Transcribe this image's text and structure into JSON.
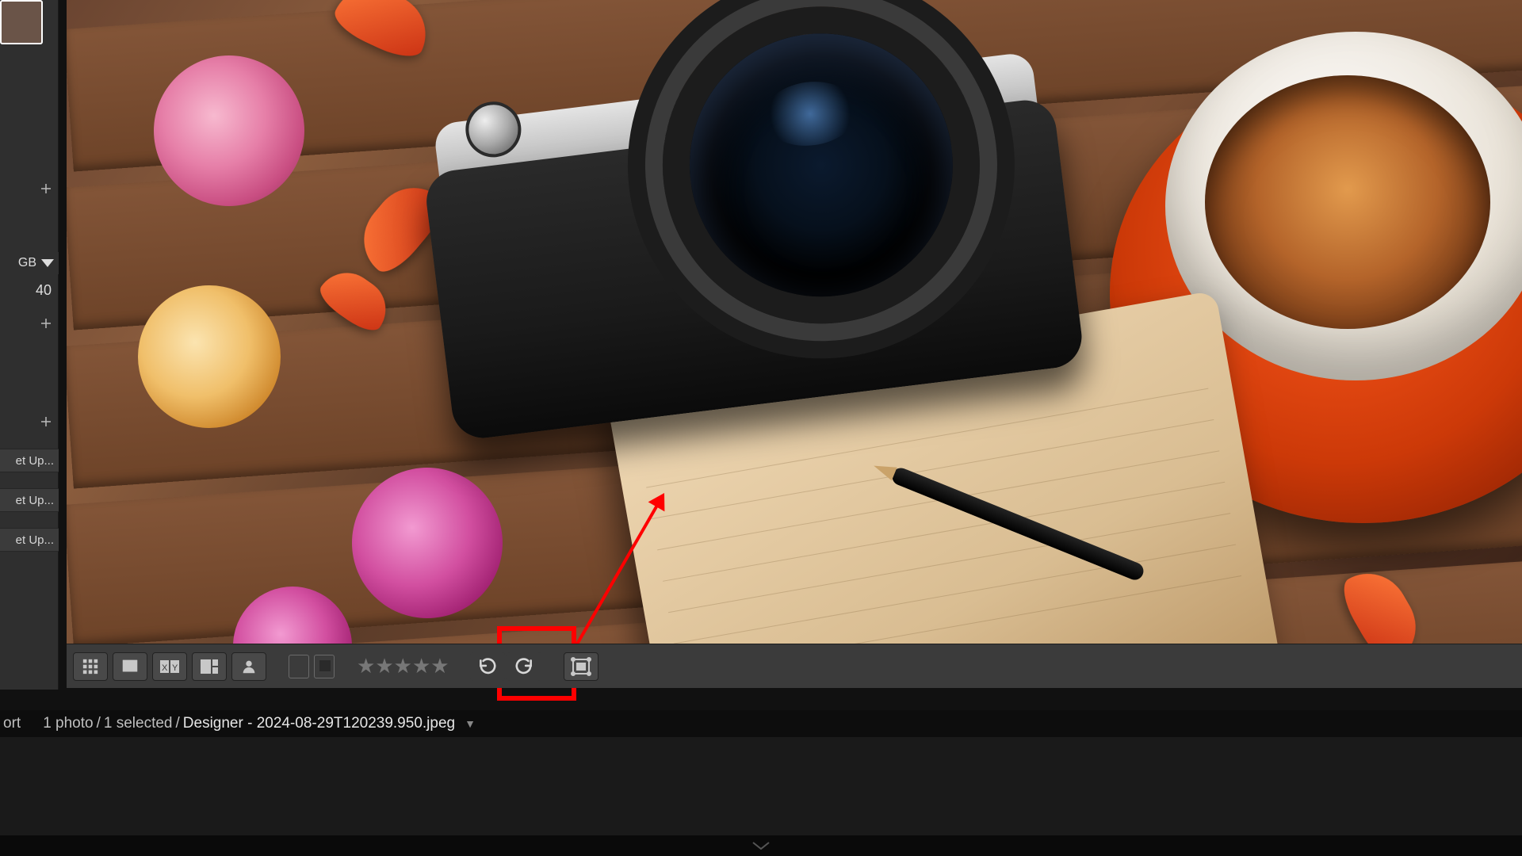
{
  "leftpanel": {
    "storage_label": "GB",
    "value_40": "40",
    "setup_labels": [
      "et Up...",
      "et Up...",
      "et Up..."
    ]
  },
  "toolbar": {
    "icons": {
      "grid": "grid-view-icon",
      "loupe": "loupe-view-icon",
      "compare": "compare-view-icon",
      "survey": "survey-view-icon",
      "people": "people-view-icon",
      "flag_pick": "flag-pick-icon",
      "flag_reject": "flag-reject-icon",
      "rotate_ccw": "rotate-ccw-icon",
      "rotate_cw": "rotate-cw-icon",
      "sync": "sync-settings-icon"
    },
    "star_glyph": "★"
  },
  "status": {
    "sort_label": "ort",
    "count": "1 photo",
    "selected": "1 selected",
    "filename": "Designer - 2024-08-29T120239.950.jpeg",
    "sep": " / "
  },
  "annotation": {
    "target": "rotate-buttons",
    "color": "#ff0000"
  }
}
